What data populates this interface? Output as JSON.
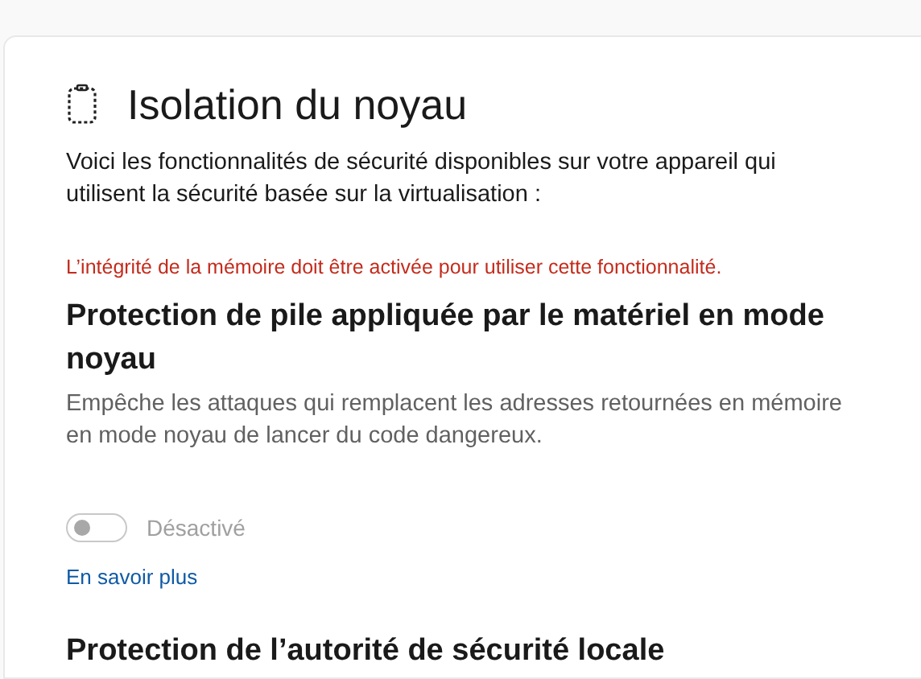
{
  "title": "Isolation du noyau",
  "description": "Voici les fonctionnalités de sécurité disponibles sur votre appareil qui utilisent la sécurité basée sur la virtualisation :",
  "warning": "L’intégrité de la mémoire doit être activée pour utiliser cette fonctionnalité.",
  "features": [
    {
      "title": "Protection de pile appliquée par le matériel en mode noyau",
      "description": "Empêche les attaques qui remplacent les adresses retournées en mémoire en mode noyau de lancer du code dangereux.",
      "toggle": {
        "on": false,
        "disabled": true,
        "label": "Désactivé"
      },
      "link": "En savoir plus"
    },
    {
      "title": "Protection de l’autorité de sécurité locale"
    }
  ]
}
